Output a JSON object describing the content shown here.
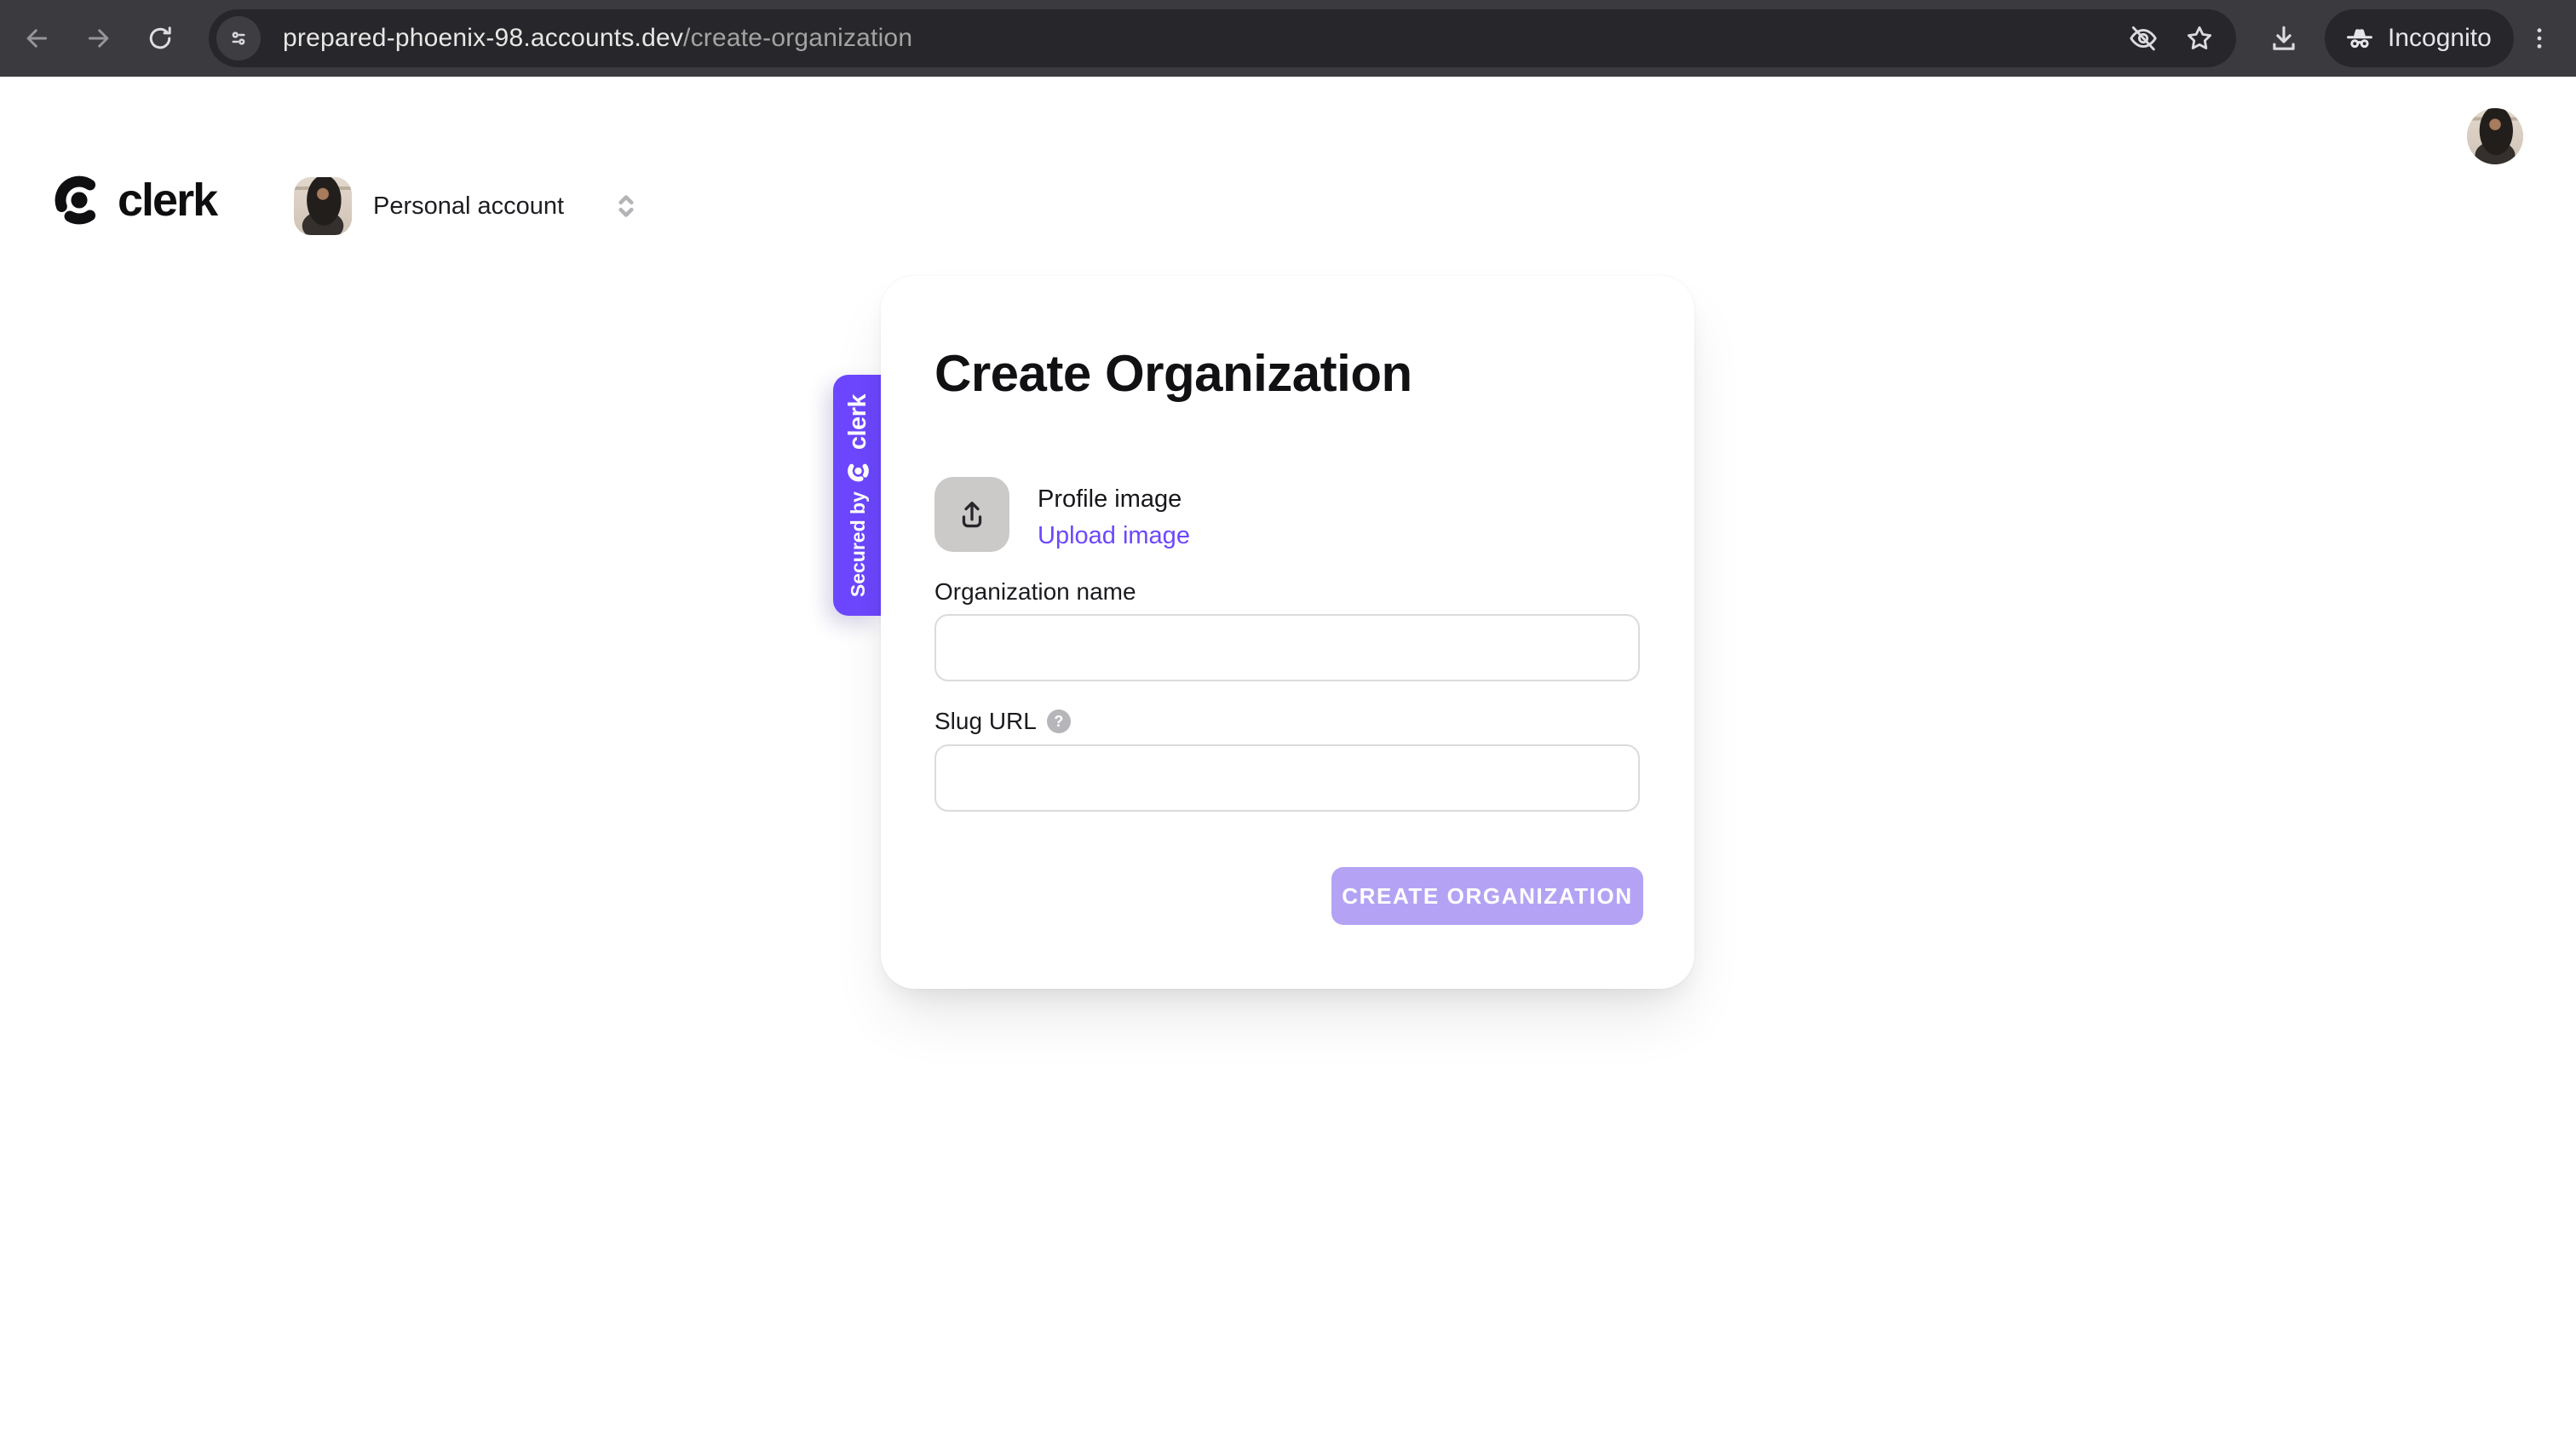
{
  "browser": {
    "url": {
      "domain": "prepared-phoenix-98.accounts.dev",
      "path": "/create-organization"
    },
    "incognito_label": "Incognito"
  },
  "header": {
    "brand": "clerk",
    "org_switcher_label": "Personal account"
  },
  "card": {
    "title": "Create Organization",
    "profile_image_label": "Profile image",
    "upload_link": "Upload image",
    "org_name_label": "Organization name",
    "org_name_value": "",
    "slug_label": "Slug URL",
    "slug_value": "",
    "help_glyph": "?",
    "submit_label": "CREATE ORGANIZATION"
  },
  "ribbon": {
    "secured_by": "Secured by",
    "brand": "clerk"
  },
  "colors": {
    "brand_purple": "#6C47FF",
    "submit_disabled": "#B4A3F4",
    "upload_box_gray": "#CBCAC8"
  }
}
